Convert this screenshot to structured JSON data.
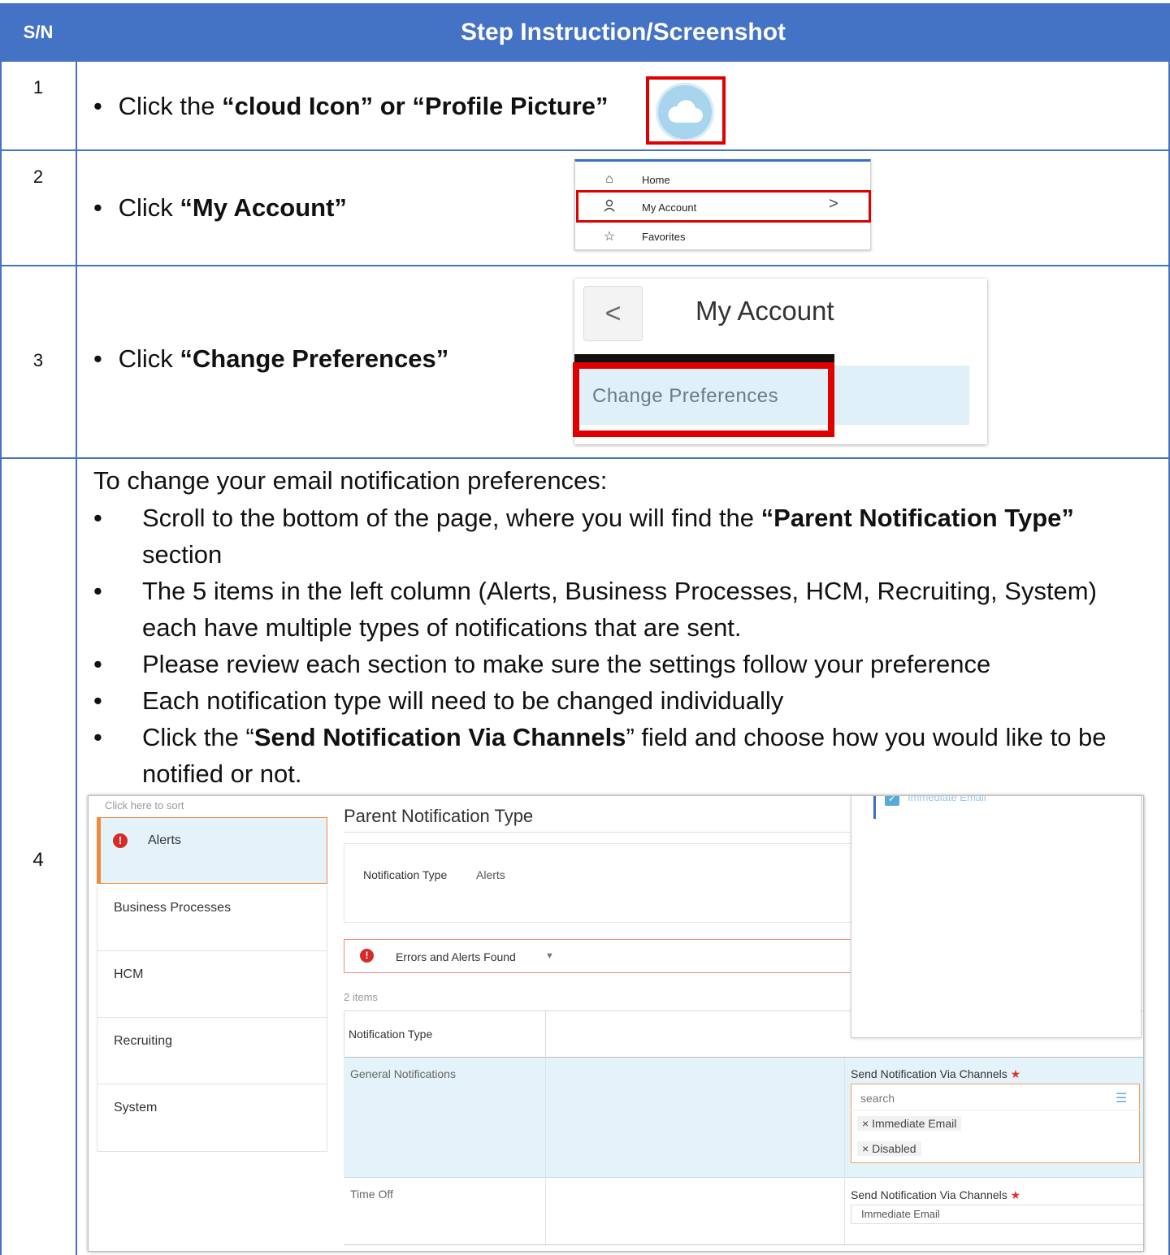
{
  "header": {
    "sn_label": "S/N",
    "title": "Step Instruction/Screenshot"
  },
  "colors": {
    "table_blue": "#4472c4",
    "highlight_red": "#e00000"
  },
  "steps": [
    {
      "num": "1",
      "pre": "Click the ",
      "bold": "“cloud Icon” or “Profile Picture”",
      "icon": "cloud-icon"
    },
    {
      "num": "2",
      "pre": "Click ",
      "bold": "“My Account”"
    },
    {
      "num": "3",
      "pre": "Click ",
      "bold": "“Change Preferences”"
    },
    {
      "num": "4"
    }
  ],
  "menu": {
    "items": [
      {
        "icon": "home-icon",
        "label": "Home"
      },
      {
        "icon": "person-icon",
        "label": "My Account"
      },
      {
        "icon": "star-icon",
        "label": "Favorites"
      }
    ]
  },
  "account": {
    "back": "<",
    "title": "My Account",
    "change_prefs": "Change Preferences"
  },
  "step4": {
    "intro": "To change your email notification preferences:",
    "bullet": "•",
    "b1_pre": "Scroll to the bottom of the page, where you will find the ",
    "b1_bold": "“Parent Notification Type”",
    "b1_post": " section",
    "b2": "The 5 items in the left column (Alerts, Business Processes, HCM, Recruiting, System) each have multiple types of notifications that are sent.",
    "b3": "Please review each section to make sure the settings follow your preference",
    "b4": "Each notification type will need to be changed individually",
    "b5_pre": "Click the “",
    "b5_bold": "Send Notification Via Channels",
    "b5_post": "” field  and choose how you would like to be notified  or not."
  },
  "screenshot": {
    "sort_hint": "Click here to sort",
    "side_items": [
      "Alerts",
      "Business Processes",
      "HCM",
      "Recruiting",
      "System"
    ],
    "panel_title": "Parent Notification Type",
    "nt_label": "Notification Type",
    "nt_value": "Alerts",
    "errors": "Errors and Alerts Found",
    "items_count": "2 items",
    "col_header": "Notification Type",
    "row1": "General Notifications",
    "row2": "Time Off",
    "channels_label": "Send Notification Via Channels",
    "required": "★",
    "search_placeholder": "search",
    "pills": [
      "Immediate Email",
      "Disabled"
    ],
    "pill_x": "×",
    "row2_value": "Immediate Email",
    "dropdown_top": "Immediate Email"
  }
}
